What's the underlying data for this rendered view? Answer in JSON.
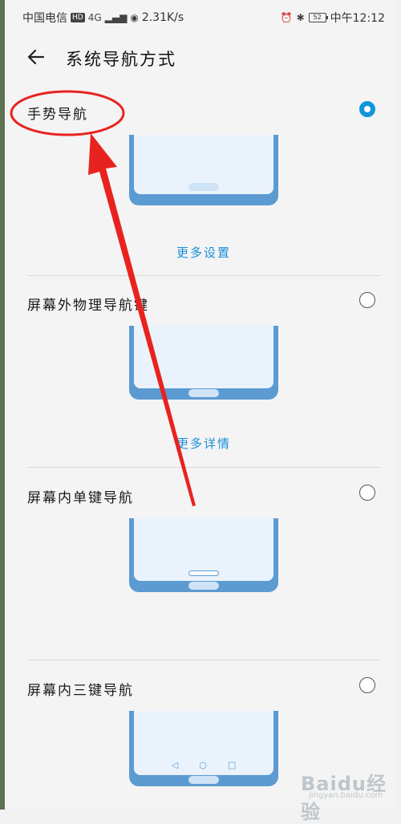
{
  "status_bar": {
    "carrier": "中国电信",
    "hd": "HD",
    "network": "4G",
    "speed": "2.31K/s",
    "battery": "52",
    "time": "中午12:12"
  },
  "header": {
    "title": "系统导航方式"
  },
  "options": [
    {
      "label": "手势导航",
      "selected": true,
      "link": "更多设置"
    },
    {
      "label": "屏幕外物理导航键",
      "selected": false,
      "link": "更多详情"
    },
    {
      "label": "屏幕内单键导航",
      "selected": false
    },
    {
      "label": "屏幕内三键导航",
      "selected": false
    }
  ],
  "nav_keys": {
    "back": "◁",
    "home": "○",
    "recent": "□"
  },
  "watermark": {
    "main": "Baidu经验",
    "sub": "jingyan.baidu.com"
  },
  "colors": {
    "accent": "#1296db",
    "phone_frame": "#5c9bd1",
    "annotation": "#e8231f"
  }
}
